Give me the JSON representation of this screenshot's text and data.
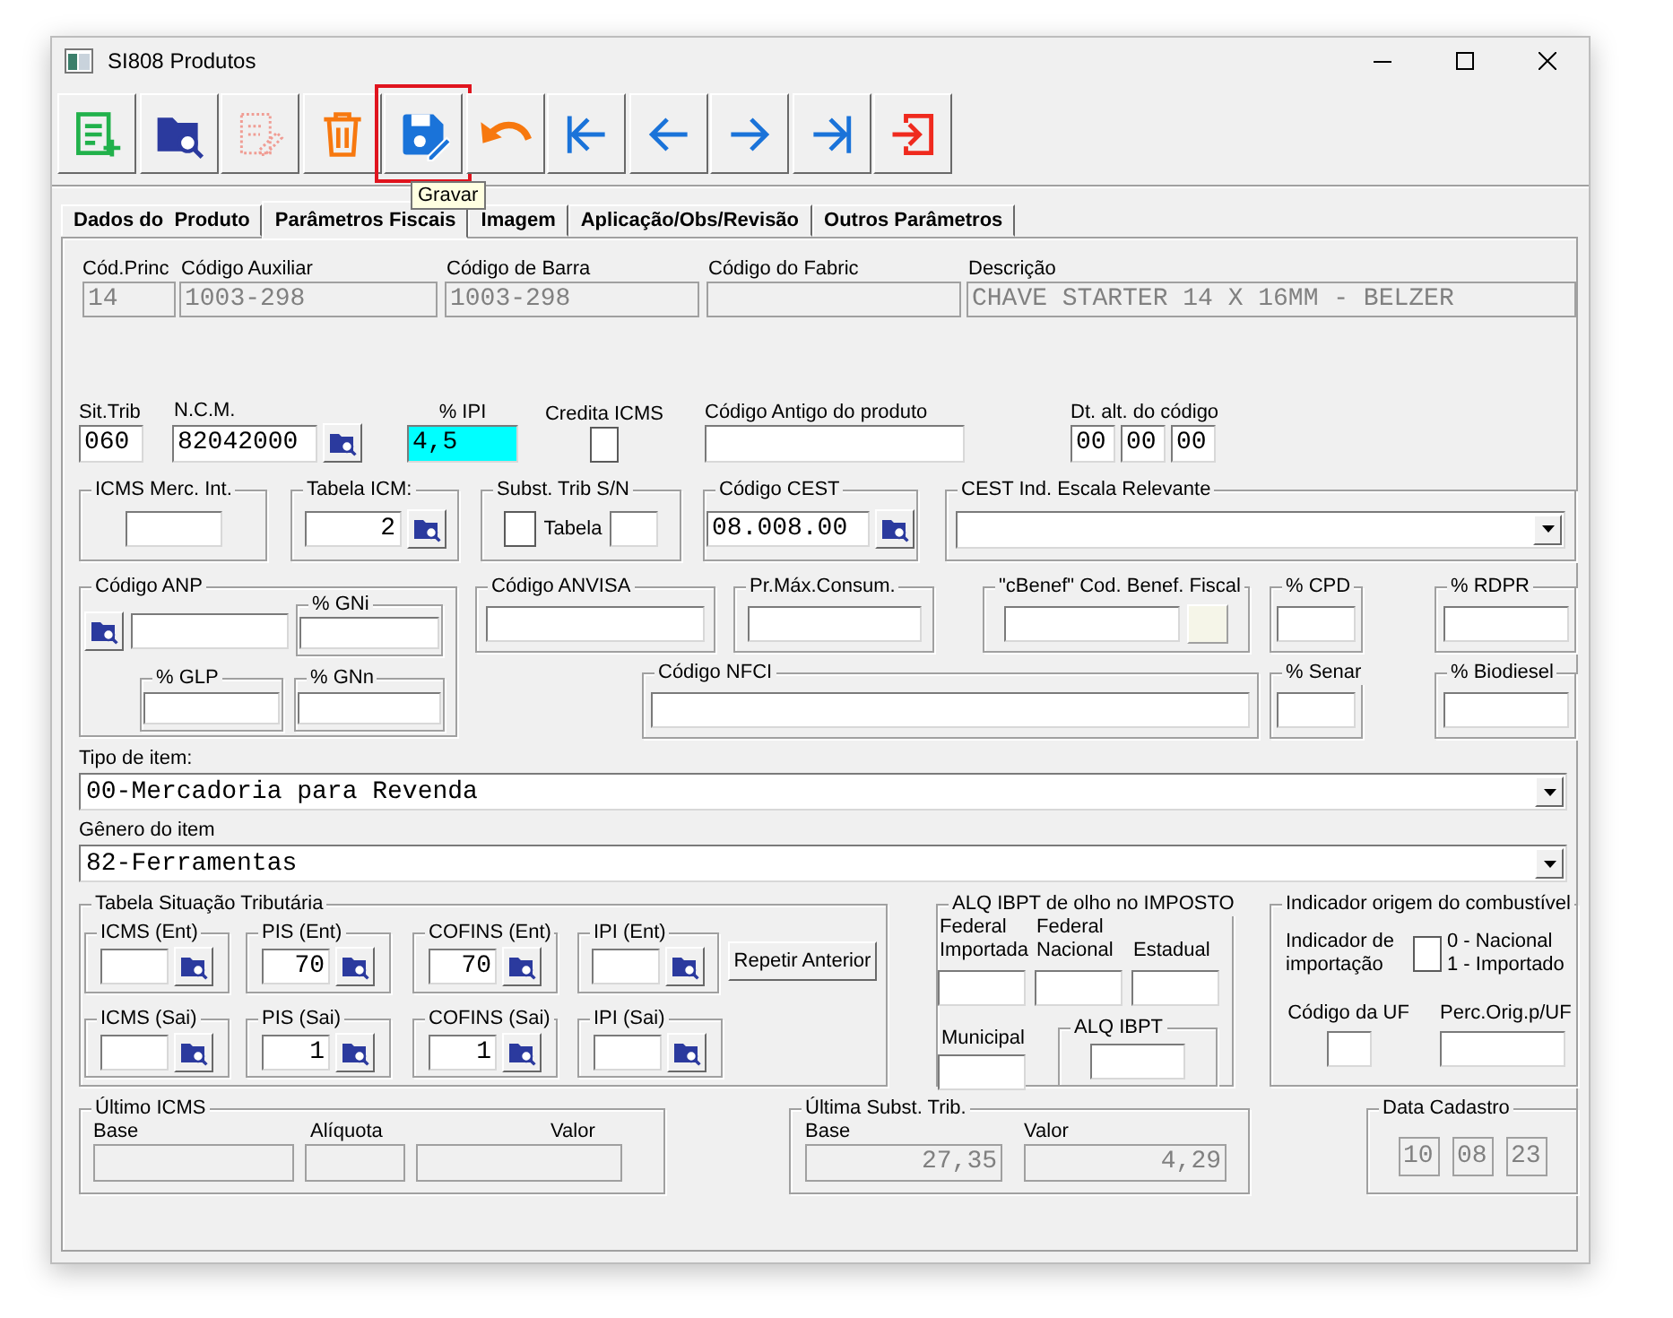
{
  "window": {
    "title": "SI808 Produtos"
  },
  "toolbar": [
    {
      "kind": "new",
      "disabled": false,
      "highlighted": false
    },
    {
      "kind": "search",
      "disabled": false,
      "highlighted": false
    },
    {
      "kind": "edit",
      "disabled": true,
      "highlighted": false
    },
    {
      "kind": "delete",
      "disabled": false,
      "highlighted": false
    },
    {
      "kind": "save",
      "disabled": false,
      "highlighted": true,
      "tooltip": "Gravar"
    },
    {
      "kind": "undo",
      "disabled": false,
      "highlighted": false
    },
    {
      "kind": "first",
      "disabled": false,
      "highlighted": false
    },
    {
      "kind": "prev",
      "disabled": false,
      "highlighted": false
    },
    {
      "kind": "next",
      "disabled": false,
      "highlighted": false
    },
    {
      "kind": "last",
      "disabled": false,
      "highlighted": false
    },
    {
      "kind": "exit",
      "disabled": false,
      "highlighted": false
    }
  ],
  "tabs": [
    {
      "label": "Dados do  Produto",
      "selected": false
    },
    {
      "label": "Parâmetros Fiscais",
      "selected": true
    },
    {
      "label": "Imagem",
      "selected": false
    },
    {
      "label": "Aplicação/Obs/Revisão",
      "selected": false
    },
    {
      "label": "Outros Parâmetros",
      "selected": false
    }
  ],
  "product": [
    {
      "label": "Cód.Princ",
      "value": "14"
    },
    {
      "label": "Código Auxiliar",
      "value": "1003-298"
    },
    {
      "label": "Código de Barra",
      "value": "1003-298"
    },
    {
      "label": "Código do Fabric"
    },
    {
      "label": "Descrição",
      "value": "CHAVE STARTER 14 X 16MM - BELZER"
    }
  ],
  "sit_trib": {
    "label": "Sit.Trib",
    "value": "060"
  },
  "ncm": {
    "label": "N.C.M.",
    "value": "82042000"
  },
  "ipi": {
    "label": "% IPI",
    "value": "4,5",
    "focused": true
  },
  "credita_icms": {
    "label": "Credita ICMS",
    "checked": false
  },
  "codigo_antigo": {
    "label": "Código Antigo do produto"
  },
  "dt_alt": {
    "label": "Dt. alt. do código",
    "values": [
      "00",
      "00",
      "00"
    ]
  },
  "icms_merc": {
    "label": "ICMS Merc. Int."
  },
  "tabela_icm": {
    "label": "Tabela ICM:",
    "value": "2"
  },
  "subst": {
    "label": "Subst. Trib S/N",
    "checked": false,
    "table_label": "Tabela"
  },
  "cest": {
    "label": "Código CEST",
    "value": "08.008.00"
  },
  "cest_escala": {
    "label": "CEST Ind. Escala Relevante"
  },
  "anp": {
    "label": "Código ANP",
    "gni": "% GNi",
    "glp": "% GLP",
    "gnn": "% GNn"
  },
  "anvisa": {
    "label": "Código ANVISA"
  },
  "pr_max": {
    "label": "Pr.Máx.Consum."
  },
  "cbenef": {
    "label": "\"cBenef\" Cod. Benef. Fiscal"
  },
  "cpd": {
    "label": "% CPD"
  },
  "rdpr": {
    "label": "% RDPR"
  },
  "nfci": {
    "label": "Código NFCI"
  },
  "senar": {
    "label": "% Senar"
  },
  "biodiesel": {
    "label": "% Biodiesel"
  },
  "tipo_item": {
    "label": "Tipo de item:",
    "value": "00-Mercadoria para Revenda"
  },
  "genero": {
    "label": "Gênero do item",
    "value": "82-Ferramentas"
  },
  "situacao": {
    "label": "Tabela Situação Tributária",
    "button": "Repetir Anterior",
    "cells": [
      {
        "label": "ICMS (Ent)"
      },
      {
        "label": "PIS (Ent)",
        "value": "70"
      },
      {
        "label": "COFINS (Ent)",
        "value": "70"
      },
      {
        "label": "IPI (Ent)"
      },
      {
        "label": "ICMS (Sai)"
      },
      {
        "label": "PIS (Sai)",
        "value": "1"
      },
      {
        "label": "COFINS (Sai)",
        "value": "1"
      },
      {
        "label": "IPI (Sai)"
      }
    ]
  },
  "ibpt": {
    "label": "ALQ IBPT de olho no IMPOSTO",
    "columns": [
      "Federal Importada",
      "Federal Nacional",
      "Estadual"
    ],
    "municipal": "Municipal",
    "alq": "ALQ IBPT"
  },
  "combustivel": {
    "label": "Indicador origem do combustível",
    "indicador": "Indicador de importação",
    "checked": false,
    "options": [
      "0 - Nacional",
      "1 - Importado"
    ],
    "uf": "Código da UF",
    "perc": "Perc.Orig.p/UF"
  },
  "ultimo_icms": {
    "label": "Último ICMS",
    "columns": [
      {
        "label": "Base"
      },
      {
        "label": "Alíquota"
      },
      {
        "label": "Valor"
      }
    ]
  },
  "ultima_subst": {
    "label": "Última Subst. Trib.",
    "columns": [
      {
        "label": "Base",
        "value": "27,35"
      },
      {
        "label": "Valor",
        "value": "4,29"
      }
    ]
  },
  "data_cadastro": {
    "label": "Data Cadastro",
    "values": [
      "10",
      "08",
      "23"
    ]
  }
}
